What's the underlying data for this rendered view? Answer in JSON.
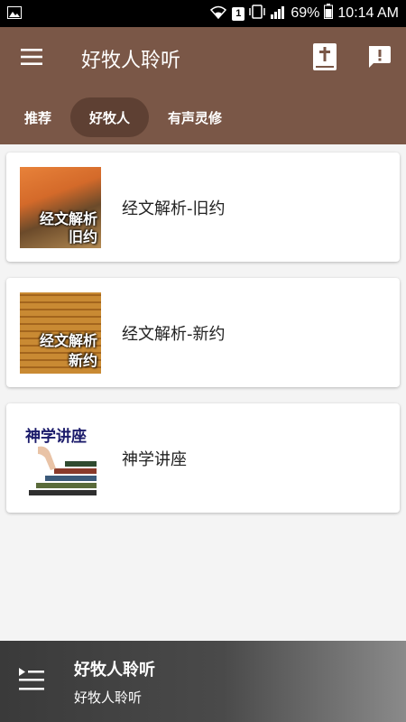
{
  "status_bar": {
    "battery": "69%",
    "time": "10:14 AM",
    "sim_slot": "1"
  },
  "app_bar": {
    "title": "好牧人聆听",
    "icons": [
      "menu-icon",
      "bible-icon",
      "feedback-icon"
    ]
  },
  "tabs": [
    {
      "label": "推荐",
      "active": false
    },
    {
      "label": "好牧人",
      "active": true
    },
    {
      "label": "有声灵修",
      "active": false
    }
  ],
  "items": [
    {
      "title": "经文解析-旧约",
      "thumb_caption_1": "经文解析",
      "thumb_caption_2": "旧约"
    },
    {
      "title": "经文解析-新约",
      "thumb_caption_1": "经文解析",
      "thumb_caption_2": "新约"
    },
    {
      "title": "神学讲座",
      "thumb_caption_1": "神学讲座"
    }
  ],
  "player": {
    "title": "好牧人聆听",
    "subtitle": "好牧人聆听"
  },
  "colors": {
    "app_bar": "#7a5747",
    "active_tab": "#5e4033",
    "background": "#f4f4f4"
  }
}
